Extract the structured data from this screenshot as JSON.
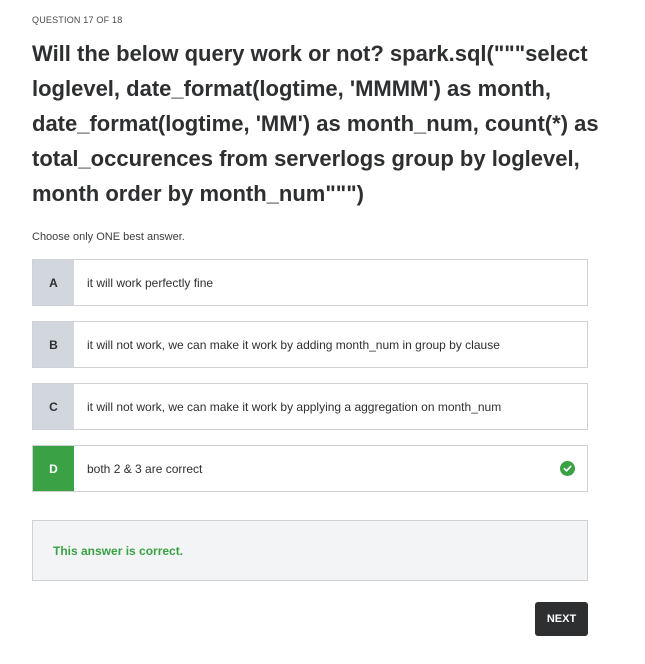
{
  "header": {
    "counter": "QUESTION 17 OF 18"
  },
  "question": {
    "text": "Will the below query work or not? spark.sql(\"\"\"select loglevel, date_format(logtime, 'MMMM') as month, date_format(logtime, 'MM') as month_num, count(*) as total_occurences from serverlogs group by loglevel, month order by month_num\"\"\")",
    "instruction": "Choose only ONE best answer."
  },
  "options": [
    {
      "letter": "A",
      "text": "it will work perfectly fine",
      "state": "default"
    },
    {
      "letter": "B",
      "text": "it will not work, we can make it work by adding month_num in group by clause",
      "state": "default"
    },
    {
      "letter": "C",
      "text": "it will not work, we can make it work by applying a aggregation on month_num",
      "state": "default"
    },
    {
      "letter": "D",
      "text": "both 2 & 3 are correct",
      "state": "correct",
      "icon": "check-circle-icon"
    }
  ],
  "feedback": {
    "message": "This answer is correct."
  },
  "footer": {
    "next_label": "NEXT"
  },
  "colors": {
    "correct": "#3aa145",
    "letter_bg": "#d1d7dc",
    "button_bg": "#2d2f31",
    "feedback_bg": "#f3f4f5"
  }
}
